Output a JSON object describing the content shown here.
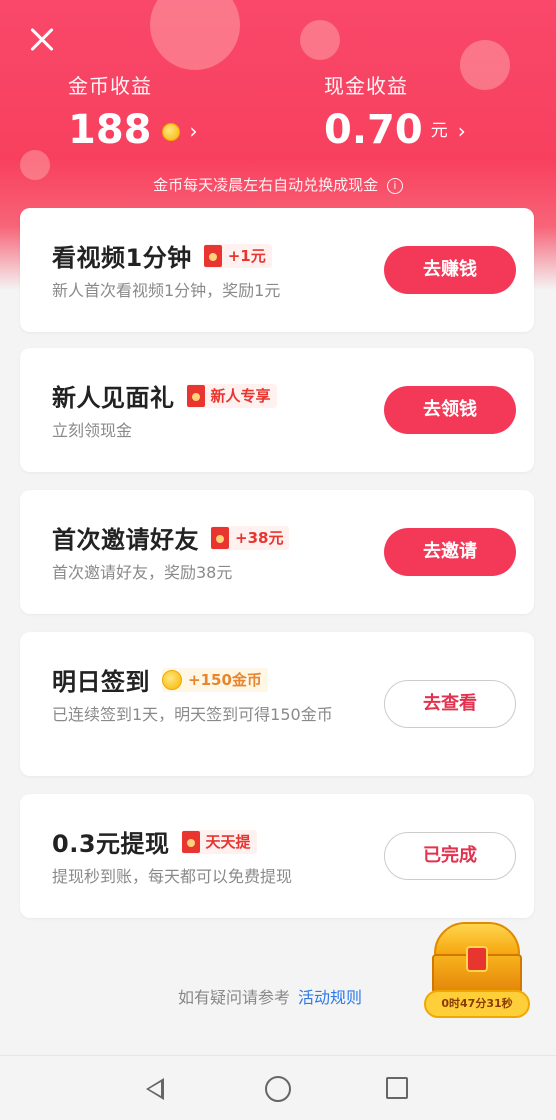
{
  "header": {
    "coin_earnings": {
      "label": "金币收益",
      "value": "188",
      "icon": "gold-coin-icon",
      "chevron": "›"
    },
    "cash_earnings": {
      "label": "现金收益",
      "value": "0.70",
      "unit": "元",
      "chevron": "›"
    },
    "notice": "金币每天凌晨左右自动兑换成现金",
    "notice_icon": "ⓘ"
  },
  "tasks": [
    {
      "title": "看视频1分钟",
      "badge_icon": "red-packet-icon",
      "badge": "+1元",
      "desc": "新人首次看视频1分钟，奖励1元",
      "button": "去赚钱",
      "button_style": "primary"
    },
    {
      "title": "新人见面礼",
      "badge_icon": "red-packet-icon",
      "badge": "新人专享",
      "desc": "立刻领现金",
      "button": "去领钱",
      "button_style": "primary"
    },
    {
      "title": "首次邀请好友",
      "badge_icon": "red-packet-icon",
      "badge": "+38元",
      "desc": "首次邀请好友，奖励38元",
      "button": "去邀请",
      "button_style": "primary"
    },
    {
      "title": "明日签到",
      "badge_icon": "gold-coin-icon",
      "badge": "+150金币",
      "desc": "已连续签到1天，明天签到可得150金币",
      "button": "去查看",
      "button_style": "outline"
    },
    {
      "title": "0.3元提现",
      "badge_icon": "red-packet-icon",
      "badge": "天天提",
      "desc": "提现秒到账，每天都可以免费提现",
      "button": "已完成",
      "button_style": "outline"
    }
  ],
  "footer": {
    "text": "如有疑问请参考",
    "link": "活动规则"
  },
  "treasure_chest": {
    "timer": "0时47分31秒"
  },
  "colors": {
    "brand": "#f43958",
    "header": "#f9486a",
    "badge_text": "#e8352f",
    "link": "#2d7ae8"
  }
}
